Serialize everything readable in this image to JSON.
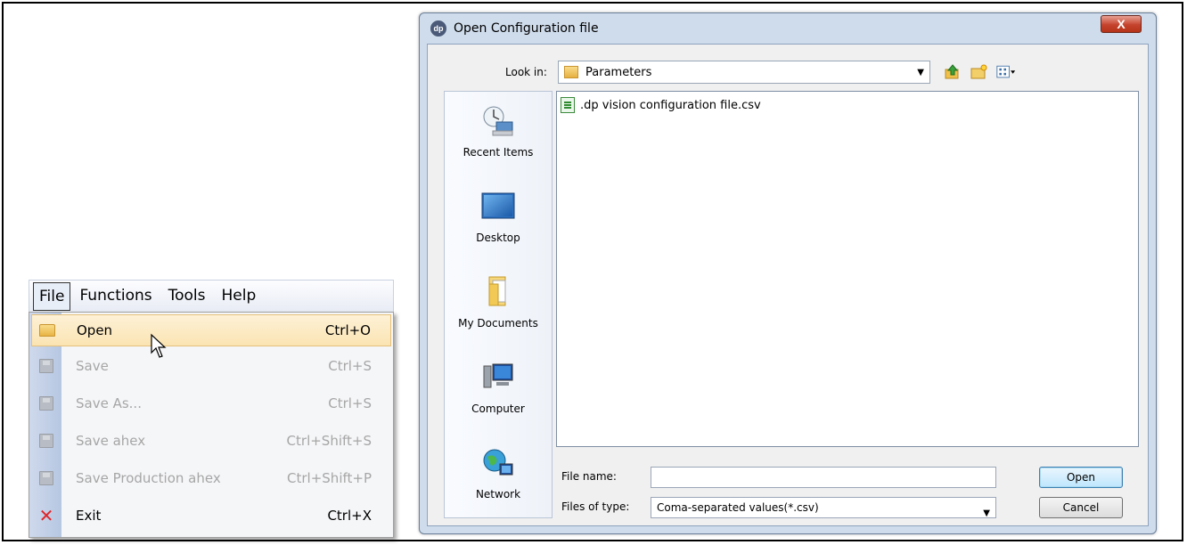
{
  "menu": {
    "bar": [
      "File",
      "Functions",
      "Tools",
      "Help"
    ],
    "items": [
      {
        "label": "Open",
        "shortcut": "Ctrl+O",
        "icon": "folder-icon",
        "enabled": true
      },
      {
        "label": "Save",
        "shortcut": "Ctrl+S",
        "icon": "floppy-icon",
        "enabled": false
      },
      {
        "label": "Save As...",
        "shortcut": "Ctrl+S",
        "icon": "floppy-icon",
        "enabled": false
      },
      {
        "label": "Save ahex",
        "shortcut": "Ctrl+Shift+S",
        "icon": "floppy-icon",
        "enabled": false
      },
      {
        "label": "Save Production ahex",
        "shortcut": "Ctrl+Shift+P",
        "icon": "floppy-icon",
        "enabled": false
      },
      {
        "label": "Exit",
        "shortcut": "Ctrl+X",
        "icon": "exit-x-icon",
        "enabled": true
      }
    ]
  },
  "dialog": {
    "title": "Open Configuration file",
    "app_icon_text": "dp",
    "close_label": "X",
    "look_in_label": "Look in:",
    "look_in_value": "Parameters",
    "places": [
      "Recent Items",
      "Desktop",
      "My Documents",
      "Computer",
      "Network"
    ],
    "files": [
      ".dp vision configuration file.csv"
    ],
    "file_name_label": "File name:",
    "file_name_value": "",
    "files_of_type_label": "Files of type:",
    "files_of_type_value": "Coma-separated values(*.csv)",
    "open_button": "Open",
    "cancel_button": "Cancel"
  }
}
